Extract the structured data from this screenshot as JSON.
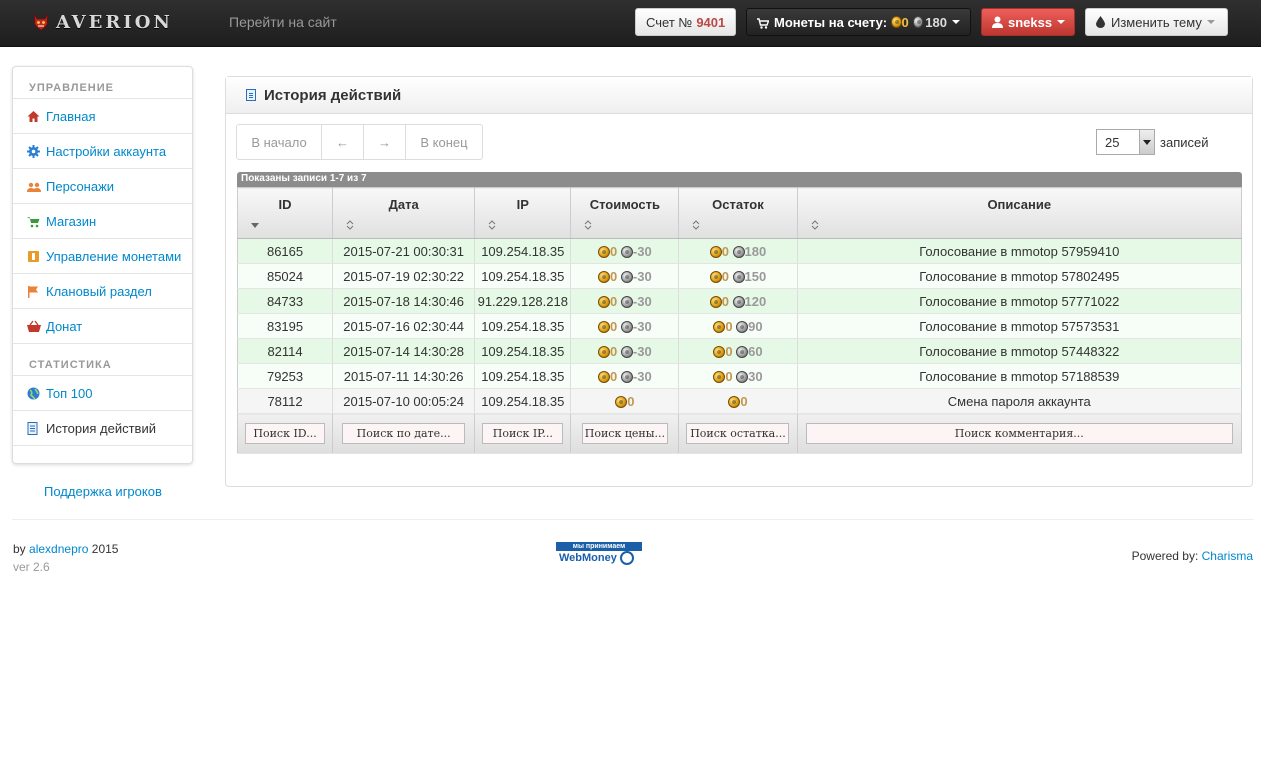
{
  "navbar": {
    "brand": "AVERION",
    "site_link": "Перейти на сайт",
    "account_label": "Счет №",
    "account_number": "9401",
    "coins_label": "Монеты на счету:",
    "coins_gold": "0",
    "coins_silver": "180",
    "user": "snekss",
    "theme_label": "Изменить тему"
  },
  "sidebar": {
    "section_manage": "УПРАВЛЕНИЕ",
    "items_manage": [
      {
        "label": "Главная",
        "icon": "home-icon"
      },
      {
        "label": "Настройки аккаунта",
        "icon": "gear-icon"
      },
      {
        "label": "Персонажи",
        "icon": "users-icon"
      },
      {
        "label": "Магазин",
        "icon": "cart-icon"
      },
      {
        "label": "Управление монетами",
        "icon": "coins-icon"
      },
      {
        "label": "Клановый раздел",
        "icon": "flag-icon"
      },
      {
        "label": "Донат",
        "icon": "basket-icon"
      }
    ],
    "section_stats": "СТАТИСТИКА",
    "items_stats": [
      {
        "label": "Топ 100",
        "icon": "globe-icon"
      },
      {
        "label": "История действий",
        "icon": "document-icon"
      }
    ],
    "support_link": "Поддержка игроков"
  },
  "panel": {
    "title": "История действий",
    "pager": {
      "first": "В начало",
      "prev": "←",
      "next": "→",
      "last": "В конец"
    },
    "per_page_value": "25",
    "per_page_label": "записей",
    "info": "Показаны записи 1-7 из 7"
  },
  "table": {
    "columns": [
      "ID",
      "Дата",
      "IP",
      "Стоимость",
      "Остаток",
      "Описание"
    ],
    "rows": [
      {
        "id": "86165",
        "date": "2015-07-21 00:30:31",
        "ip": "109.254.18.35",
        "cost_gold": "0",
        "cost_silver": "-30",
        "rest_gold": "0",
        "rest_silver": "180",
        "desc": "Голосование в mmotop 57959410"
      },
      {
        "id": "85024",
        "date": "2015-07-19 02:30:22",
        "ip": "109.254.18.35",
        "cost_gold": "0",
        "cost_silver": "-30",
        "rest_gold": "0",
        "rest_silver": "150",
        "desc": "Голосование в mmotop 57802495"
      },
      {
        "id": "84733",
        "date": "2015-07-18 14:30:46",
        "ip": "91.229.128.218",
        "cost_gold": "0",
        "cost_silver": "-30",
        "rest_gold": "0",
        "rest_silver": "120",
        "desc": "Голосование в mmotop 57771022"
      },
      {
        "id": "83195",
        "date": "2015-07-16 02:30:44",
        "ip": "109.254.18.35",
        "cost_gold": "0",
        "cost_silver": "-30",
        "rest_gold": "0",
        "rest_silver": "90",
        "desc": "Голосование в mmotop 57573531"
      },
      {
        "id": "82114",
        "date": "2015-07-14 14:30:28",
        "ip": "109.254.18.35",
        "cost_gold": "0",
        "cost_silver": "-30",
        "rest_gold": "0",
        "rest_silver": "60",
        "desc": "Голосование в mmotop 57448322"
      },
      {
        "id": "79253",
        "date": "2015-07-11 14:30:26",
        "ip": "109.254.18.35",
        "cost_gold": "0",
        "cost_silver": "-30",
        "rest_gold": "0",
        "rest_silver": "30",
        "desc": "Голосование в mmotop 57188539"
      },
      {
        "id": "78112",
        "date": "2015-07-10 00:05:24",
        "ip": "109.254.18.35",
        "cost_gold": "0",
        "cost_silver": null,
        "rest_gold": "0",
        "rest_silver": null,
        "desc": "Смена пароля аккаунта"
      }
    ],
    "filters": [
      "Поиск ID...",
      "Поиск по дате...",
      "Поиск IP...",
      "Поиск цены...",
      "Поиск остатка...",
      "Поиск комментария..."
    ]
  },
  "footer": {
    "by": "by",
    "author": "alexdnepro",
    "year": "2015",
    "version": "ver 2.6",
    "webmoney_top": "мы принимаем",
    "webmoney_bottom": "WebMoney",
    "powered_by": "Powered by:",
    "powered_link": "Charisma"
  }
}
